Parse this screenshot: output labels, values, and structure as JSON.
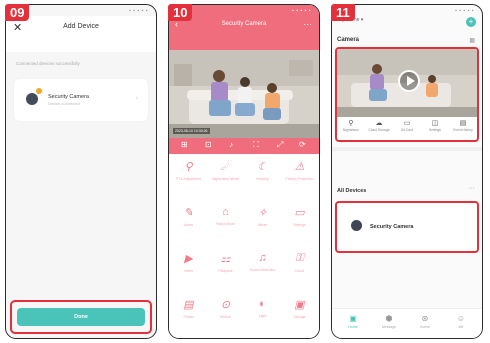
{
  "steps": [
    "09",
    "10",
    "11"
  ],
  "status_icons": "▪ ▪ ▪ ▪ ▪",
  "screen1": {
    "close_icon": "✕",
    "title": "Add Device",
    "subtitle": "Connected devices successfully",
    "device_name": "Security Camera",
    "device_desc": "Device connected",
    "chevron": "›",
    "done_label": "Done"
  },
  "screen2": {
    "back_icon": "‹",
    "title": "Security Camera",
    "more_icon": "···",
    "watermark": "2023-08-10 10:30:26",
    "controls": [
      "⊞",
      "⊡",
      "♪",
      "⛶",
      "⤢",
      "⟳"
    ],
    "grid": [
      {
        "icon": "⚲",
        "label": "PTZ Adjustment"
      },
      {
        "icon": "☄",
        "label": "Nightvision Mode"
      },
      {
        "icon": "☾",
        "label": "Security"
      },
      {
        "icon": "⚠",
        "label": "Privacy Protection"
      },
      {
        "icon": "✎",
        "label": "Alarm"
      },
      {
        "icon": "⌂",
        "label": "Patrol Mode"
      },
      {
        "icon": "✧",
        "label": "Album"
      },
      {
        "icon": "▭",
        "label": "Settings"
      },
      {
        "icon": "▶",
        "label": "Video"
      },
      {
        "icon": "⚏",
        "label": "Playback"
      },
      {
        "icon": "♫",
        "label": "Sound Detection"
      },
      {
        "icon": "⚿",
        "label": "Cloud"
      },
      {
        "icon": "▤",
        "label": "Preset"
      },
      {
        "icon": "⊙",
        "label": "Motion"
      },
      {
        "icon": "◐",
        "label": "Light"
      },
      {
        "icon": "▣",
        "label": "Storage"
      }
    ]
  },
  "screen3": {
    "home_label": "My Home ▾",
    "plus_icon": "+",
    "section_title": "Camera",
    "grid_icon": "▦",
    "quick_actions": [
      {
        "icon": "⚲",
        "label": "Nightvision"
      },
      {
        "icon": "☁",
        "label": "Cloud Storage"
      },
      {
        "icon": "▭",
        "label": "Sd Card"
      },
      {
        "icon": "◫",
        "label": "Settings"
      },
      {
        "icon": "▤",
        "label": "Event History"
      }
    ],
    "all_devices": "All Devices",
    "all_more": "···",
    "device_name": "Security Camera",
    "tabs": [
      {
        "icon": "▣",
        "label": "Home"
      },
      {
        "icon": "⬢",
        "label": "Message"
      },
      {
        "icon": "⊛",
        "label": "Scene"
      },
      {
        "icon": "☺",
        "label": "Me"
      }
    ]
  }
}
